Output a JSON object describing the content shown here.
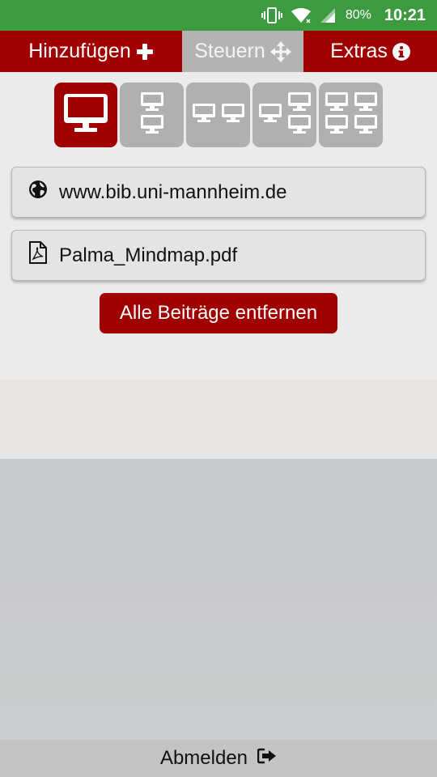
{
  "status_bar": {
    "battery_percent": "80%",
    "time": "10:21",
    "icons": [
      "vibrate-icon",
      "wifi-icon",
      "signal-icon"
    ]
  },
  "tabs": {
    "add_label": "Hinzufügen",
    "control_label": "Steuern",
    "extras_label": "Extras",
    "active": "control"
  },
  "layouts": {
    "options": [
      "single",
      "two-stacked",
      "two-side-by-side",
      "one-plus-two",
      "four-grid"
    ],
    "active_index": 0
  },
  "sources": [
    {
      "icon": "globe-icon",
      "label": "www.bib.uni-mannheim.de"
    },
    {
      "icon": "pdf-file-icon",
      "label": "Palma_Mindmap.pdf"
    }
  ],
  "remove_all_label": "Alle Beiträge entfernen",
  "footer": {
    "logout_label": "Abmelden"
  },
  "colors": {
    "status_bar": "#3e9a3e",
    "brand_red": "#a00000",
    "inactive_gray": "#b0b0b0"
  }
}
